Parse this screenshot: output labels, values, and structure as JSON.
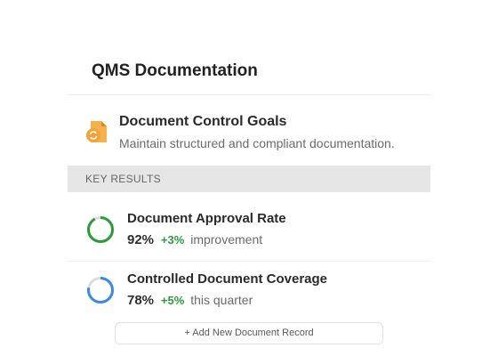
{
  "header": {
    "title": "QMS Documentation"
  },
  "goal": {
    "icon": "document-sync-icon",
    "title": "Document Control Goals",
    "description": "Maintain structured and compliant documentation.",
    "icon_color": "#f2a33a"
  },
  "section": {
    "label": "KEY RESULTS"
  },
  "key_results": [
    {
      "title": "Document Approval Rate",
      "value": "92%",
      "delta": "+3%",
      "suffix": "improvement",
      "progress": 0.92,
      "ring_color": "#2e9b3b"
    },
    {
      "title": "Controlled Document Coverage",
      "value": "78%",
      "delta": "+5%",
      "suffix": "this quarter",
      "progress": 0.78,
      "ring_color": "#3d8be0"
    }
  ],
  "actions": {
    "add_label": "+ Add New Document Record"
  },
  "colors": {
    "delta_positive": "#2e9b3b",
    "ring_track": "#dcdcdc"
  }
}
